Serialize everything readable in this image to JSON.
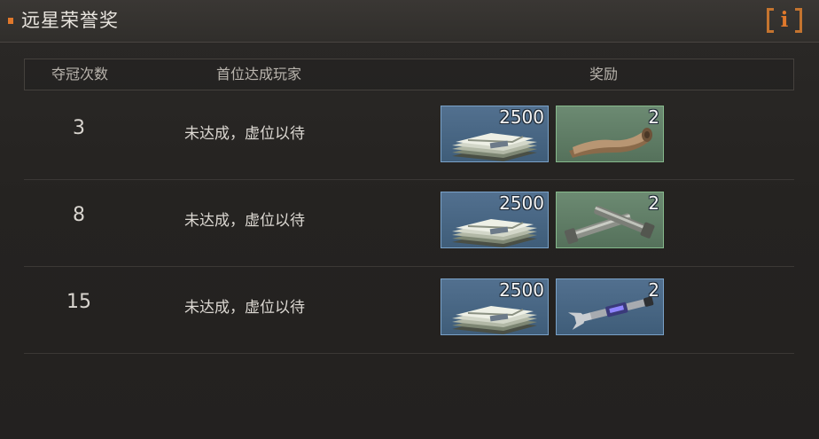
{
  "header": {
    "title": "远星荣誉奖",
    "info_label": "i"
  },
  "table": {
    "columns": [
      "夺冠次数",
      "首位达成玩家",
      "奖励"
    ],
    "rows": [
      {
        "count": "3",
        "first_player": "未达成，虚位以待",
        "rewards": [
          {
            "item": "cash-bundle-icon",
            "qty": "2500"
          },
          {
            "item": "leather-scroll-icon",
            "qty": "2"
          }
        ]
      },
      {
        "count": "8",
        "first_player": "未达成，虚位以待",
        "rewards": [
          {
            "item": "cash-bundle-icon",
            "qty": "2500"
          },
          {
            "item": "metal-bolts-icon",
            "qty": "2"
          }
        ]
      },
      {
        "count": "15",
        "first_player": "未达成，虚位以待",
        "rewards": [
          {
            "item": "cash-bundle-icon",
            "qty": "2500"
          },
          {
            "item": "wrench-tool-icon",
            "qty": "2"
          }
        ]
      }
    ]
  },
  "colors": {
    "accent": "#e0782b",
    "blue_frame": "#7aa2c8",
    "green_frame": "#86b98c"
  }
}
